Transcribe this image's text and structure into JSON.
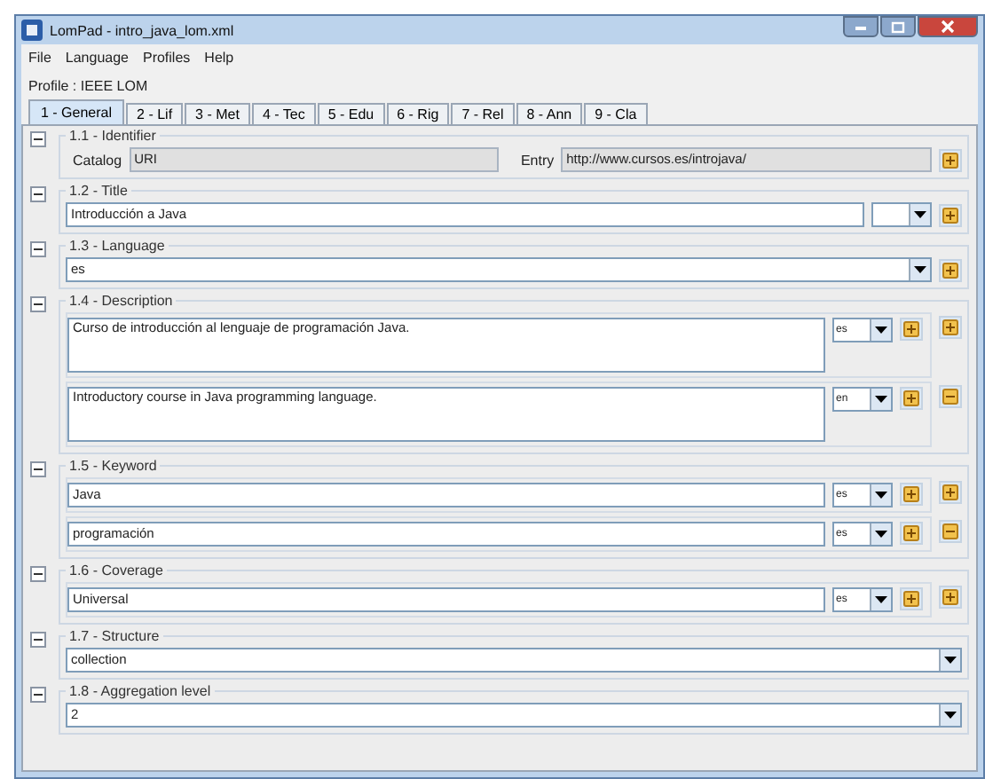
{
  "window": {
    "title": "LomPad - intro_java_lom.xml"
  },
  "menu": [
    "File",
    "Language",
    "Profiles",
    "Help"
  ],
  "profile": "Profile : IEEE LOM",
  "tabs": [
    {
      "label": "1 - General",
      "selected": true
    },
    {
      "label": "2 - Lif",
      "selected": false
    },
    {
      "label": "3 - Met",
      "selected": false
    },
    {
      "label": "4 - Tec",
      "selected": false
    },
    {
      "label": "5 - Edu",
      "selected": false
    },
    {
      "label": "6 - Rig",
      "selected": false
    },
    {
      "label": "7 - Rel",
      "selected": false
    },
    {
      "label": "8 - Ann",
      "selected": false
    },
    {
      "label": "9 - Cla",
      "selected": false
    }
  ],
  "sections": [
    {
      "label": "1.1 - Identifier",
      "expanded": true,
      "rows": [
        {
          "kind": "identifier",
          "catalog_label": "Catalog",
          "catalog": "URI",
          "entry_label": "Entry",
          "entry": "http://www.cursos.es/introjava/",
          "buttons": [
            {
              "kind": "add"
            }
          ]
        }
      ]
    },
    {
      "label": "1.2 - Title",
      "expanded": true,
      "rows": [
        {
          "kind": "text_lang",
          "value": "Introducción a Java",
          "buttons": [
            {
              "kind": "add"
            }
          ]
        }
      ]
    },
    {
      "label": "1.3 - Language",
      "expanded": true,
      "rows": [
        {
          "kind": "combo",
          "value": "es",
          "buttons": [
            {
              "kind": "add"
            }
          ]
        }
      ]
    },
    {
      "label": "1.4 - Description",
      "expanded": true,
      "rows": [
        {
          "kind": "textarea",
          "value": "Curso de introducción al lenguaje de programación Java.",
          "lang": "es",
          "buttons": [
            {
              "kind": "add"
            },
            {
              "kind": "add"
            }
          ]
        },
        {
          "kind": "textarea",
          "value": "Introductory course in Java programming language.",
          "lang": "en",
          "buttons": [
            {
              "kind": "add"
            },
            {
              "kind": "remove"
            }
          ]
        }
      ]
    },
    {
      "label": "1.5 - Keyword",
      "expanded": true,
      "rows": [
        {
          "kind": "text_lang",
          "value": "Java",
          "lang": "es",
          "buttons": [
            {
              "kind": "add"
            },
            {
              "kind": "add"
            }
          ]
        },
        {
          "kind": "text_lang",
          "value": "programación",
          "lang": "es",
          "buttons": [
            {
              "kind": "add"
            },
            {
              "kind": "remove"
            }
          ]
        }
      ]
    },
    {
      "label": "1.6 - Coverage",
      "expanded": true,
      "rows": [
        {
          "kind": "text_lang",
          "value": "Universal",
          "lang": "es",
          "buttons": [
            {
              "kind": "add"
            },
            {
              "kind": "add"
            }
          ]
        }
      ]
    },
    {
      "label": "1.7 - Structure",
      "expanded": true,
      "rows": [
        {
          "kind": "combo",
          "value": "collection",
          "buttons": []
        }
      ]
    },
    {
      "label": "1.8 - Aggregation level",
      "expanded": true,
      "rows": [
        {
          "kind": "combo",
          "value": "2",
          "buttons": []
        }
      ]
    }
  ]
}
